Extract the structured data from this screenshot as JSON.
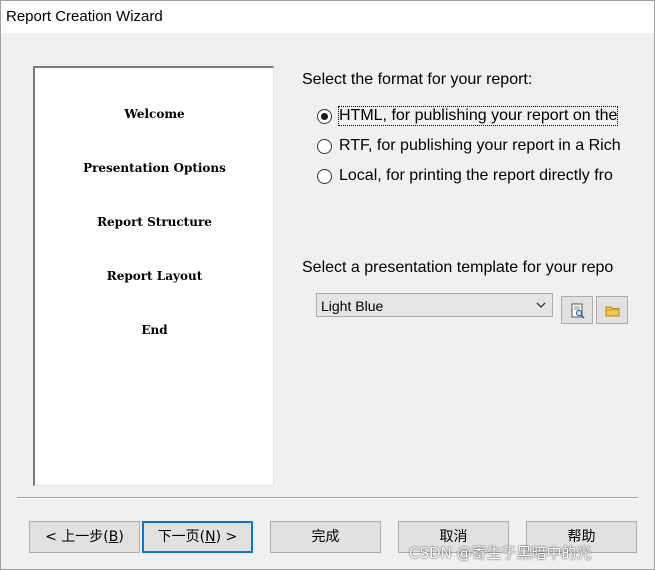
{
  "window": {
    "title": "Report Creation Wizard"
  },
  "steps": [
    {
      "label": "Welcome"
    },
    {
      "label": "Presentation Options"
    },
    {
      "label": "Report Structure"
    },
    {
      "label": "Report Layout"
    },
    {
      "label": "End"
    }
  ],
  "format": {
    "heading": "Select the format for your report:",
    "options": [
      {
        "label": "HTML, for publishing your report on the",
        "checked": true
      },
      {
        "label": "RTF, for publishing your report in a Rich",
        "checked": false
      },
      {
        "label": "Local, for printing the report directly fro",
        "checked": false
      }
    ]
  },
  "template": {
    "heading": "Select a presentation template for your repo",
    "selected": "Light Blue",
    "preview_icon": "preview-icon",
    "open_folder_icon": "folder-icon"
  },
  "buttons": {
    "back_prefix": "< 上一步(",
    "back_key": "B",
    "back_suffix": ")",
    "next_prefix": "下一页(",
    "next_key": "N",
    "next_suffix": ") >",
    "finish": "完成",
    "cancel": "取消",
    "help": "帮助"
  },
  "watermark": "CSDN @寄生于黑暗中的光",
  "colors": {
    "focus_border": "#0078d7",
    "button_face": "#e1e1e1",
    "dialog_bg": "#f0f0f0"
  }
}
